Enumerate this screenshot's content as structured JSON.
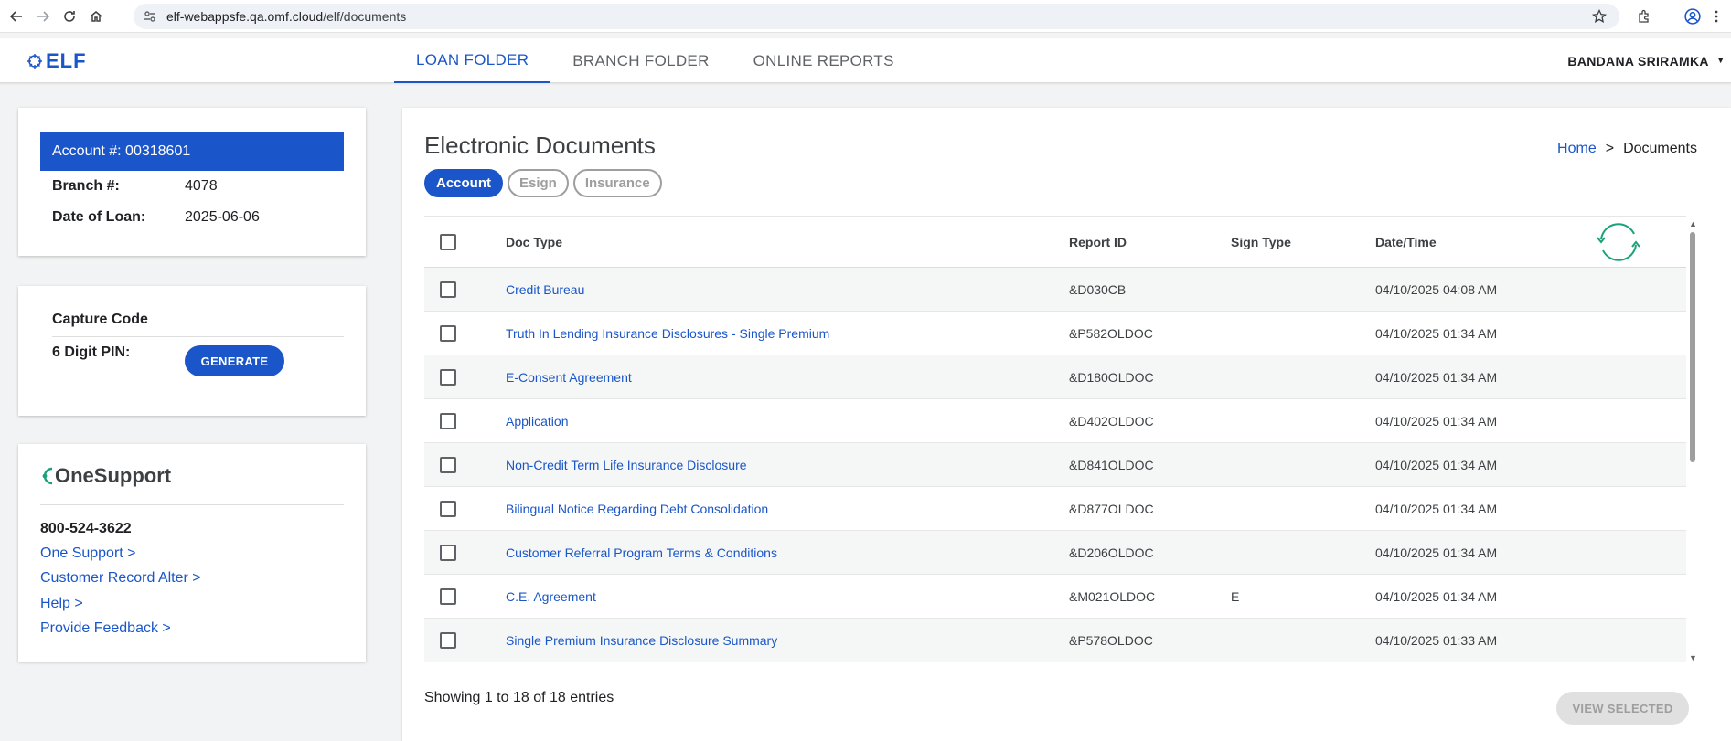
{
  "browser": {
    "url_host": "elf-webappsfe.qa.omf.cloud",
    "url_path": "/elf/documents"
  },
  "header": {
    "logo_text": "ELF",
    "tabs": [
      {
        "label": "LOAN FOLDER",
        "active": true
      },
      {
        "label": "BRANCH FOLDER",
        "active": false
      },
      {
        "label": "ONLINE REPORTS",
        "active": false
      }
    ],
    "user_name": "BANDANA SRIRAMKA"
  },
  "account_card": {
    "account_label": "Account #: 00318601",
    "branch_label": "Branch #:",
    "branch_value": "4078",
    "date_label": "Date of Loan:",
    "date_value": "2025-06-06"
  },
  "capture_card": {
    "title": "Capture Code",
    "pin_label": "6 Digit PIN:",
    "generate_label": "GENERATE"
  },
  "support_card": {
    "logo_text": "OneSupport",
    "phone": "800-524-3622",
    "links": [
      "One Support >",
      "Customer Record Alter >",
      "Help >",
      "Provide Feedback >"
    ]
  },
  "main": {
    "title": "Electronic Documents",
    "breadcrumb": {
      "home": "Home",
      "separator": ">",
      "current": "Documents"
    },
    "pills": [
      {
        "label": "Account",
        "active": true
      },
      {
        "label": "Esign",
        "active": false
      },
      {
        "label": "Insurance",
        "active": false
      }
    ],
    "table": {
      "columns": [
        "Doc Type",
        "Report ID",
        "Sign Type",
        "Date/Time"
      ],
      "rows": [
        {
          "doc": "Credit Bureau",
          "report": "&D030CB",
          "sign": "",
          "date": "04/10/2025 04:08 AM"
        },
        {
          "doc": "Truth In Lending Insurance Disclosures - Single Premium",
          "report": "&P582OLDOC",
          "sign": "",
          "date": "04/10/2025 01:34 AM"
        },
        {
          "doc": "E-Consent Agreement",
          "report": "&D180OLDOC",
          "sign": "",
          "date": "04/10/2025 01:34 AM"
        },
        {
          "doc": "Application",
          "report": "&D402OLDOC",
          "sign": "",
          "date": "04/10/2025 01:34 AM"
        },
        {
          "doc": "Non-Credit Term Life Insurance Disclosure",
          "report": "&D841OLDOC",
          "sign": "",
          "date": "04/10/2025 01:34 AM"
        },
        {
          "doc": "Bilingual Notice Regarding Debt Consolidation",
          "report": "&D877OLDOC",
          "sign": "",
          "date": "04/10/2025 01:34 AM"
        },
        {
          "doc": "Customer Referral Program Terms & Conditions",
          "report": "&D206OLDOC",
          "sign": "",
          "date": "04/10/2025 01:34 AM"
        },
        {
          "doc": "C.E. Agreement",
          "report": "&M021OLDOC",
          "sign": "E",
          "date": "04/10/2025 01:34 AM"
        },
        {
          "doc": "Single Premium Insurance Disclosure Summary",
          "report": "&P578OLDOC",
          "sign": "",
          "date": "04/10/2025 01:33 AM"
        }
      ]
    },
    "entries_text": "Showing 1 to 18 of 18 entries",
    "view_selected_label": "VIEW SELECTED"
  },
  "colors": {
    "accent": "#1a56c9",
    "refresh": "#1aa37a"
  }
}
